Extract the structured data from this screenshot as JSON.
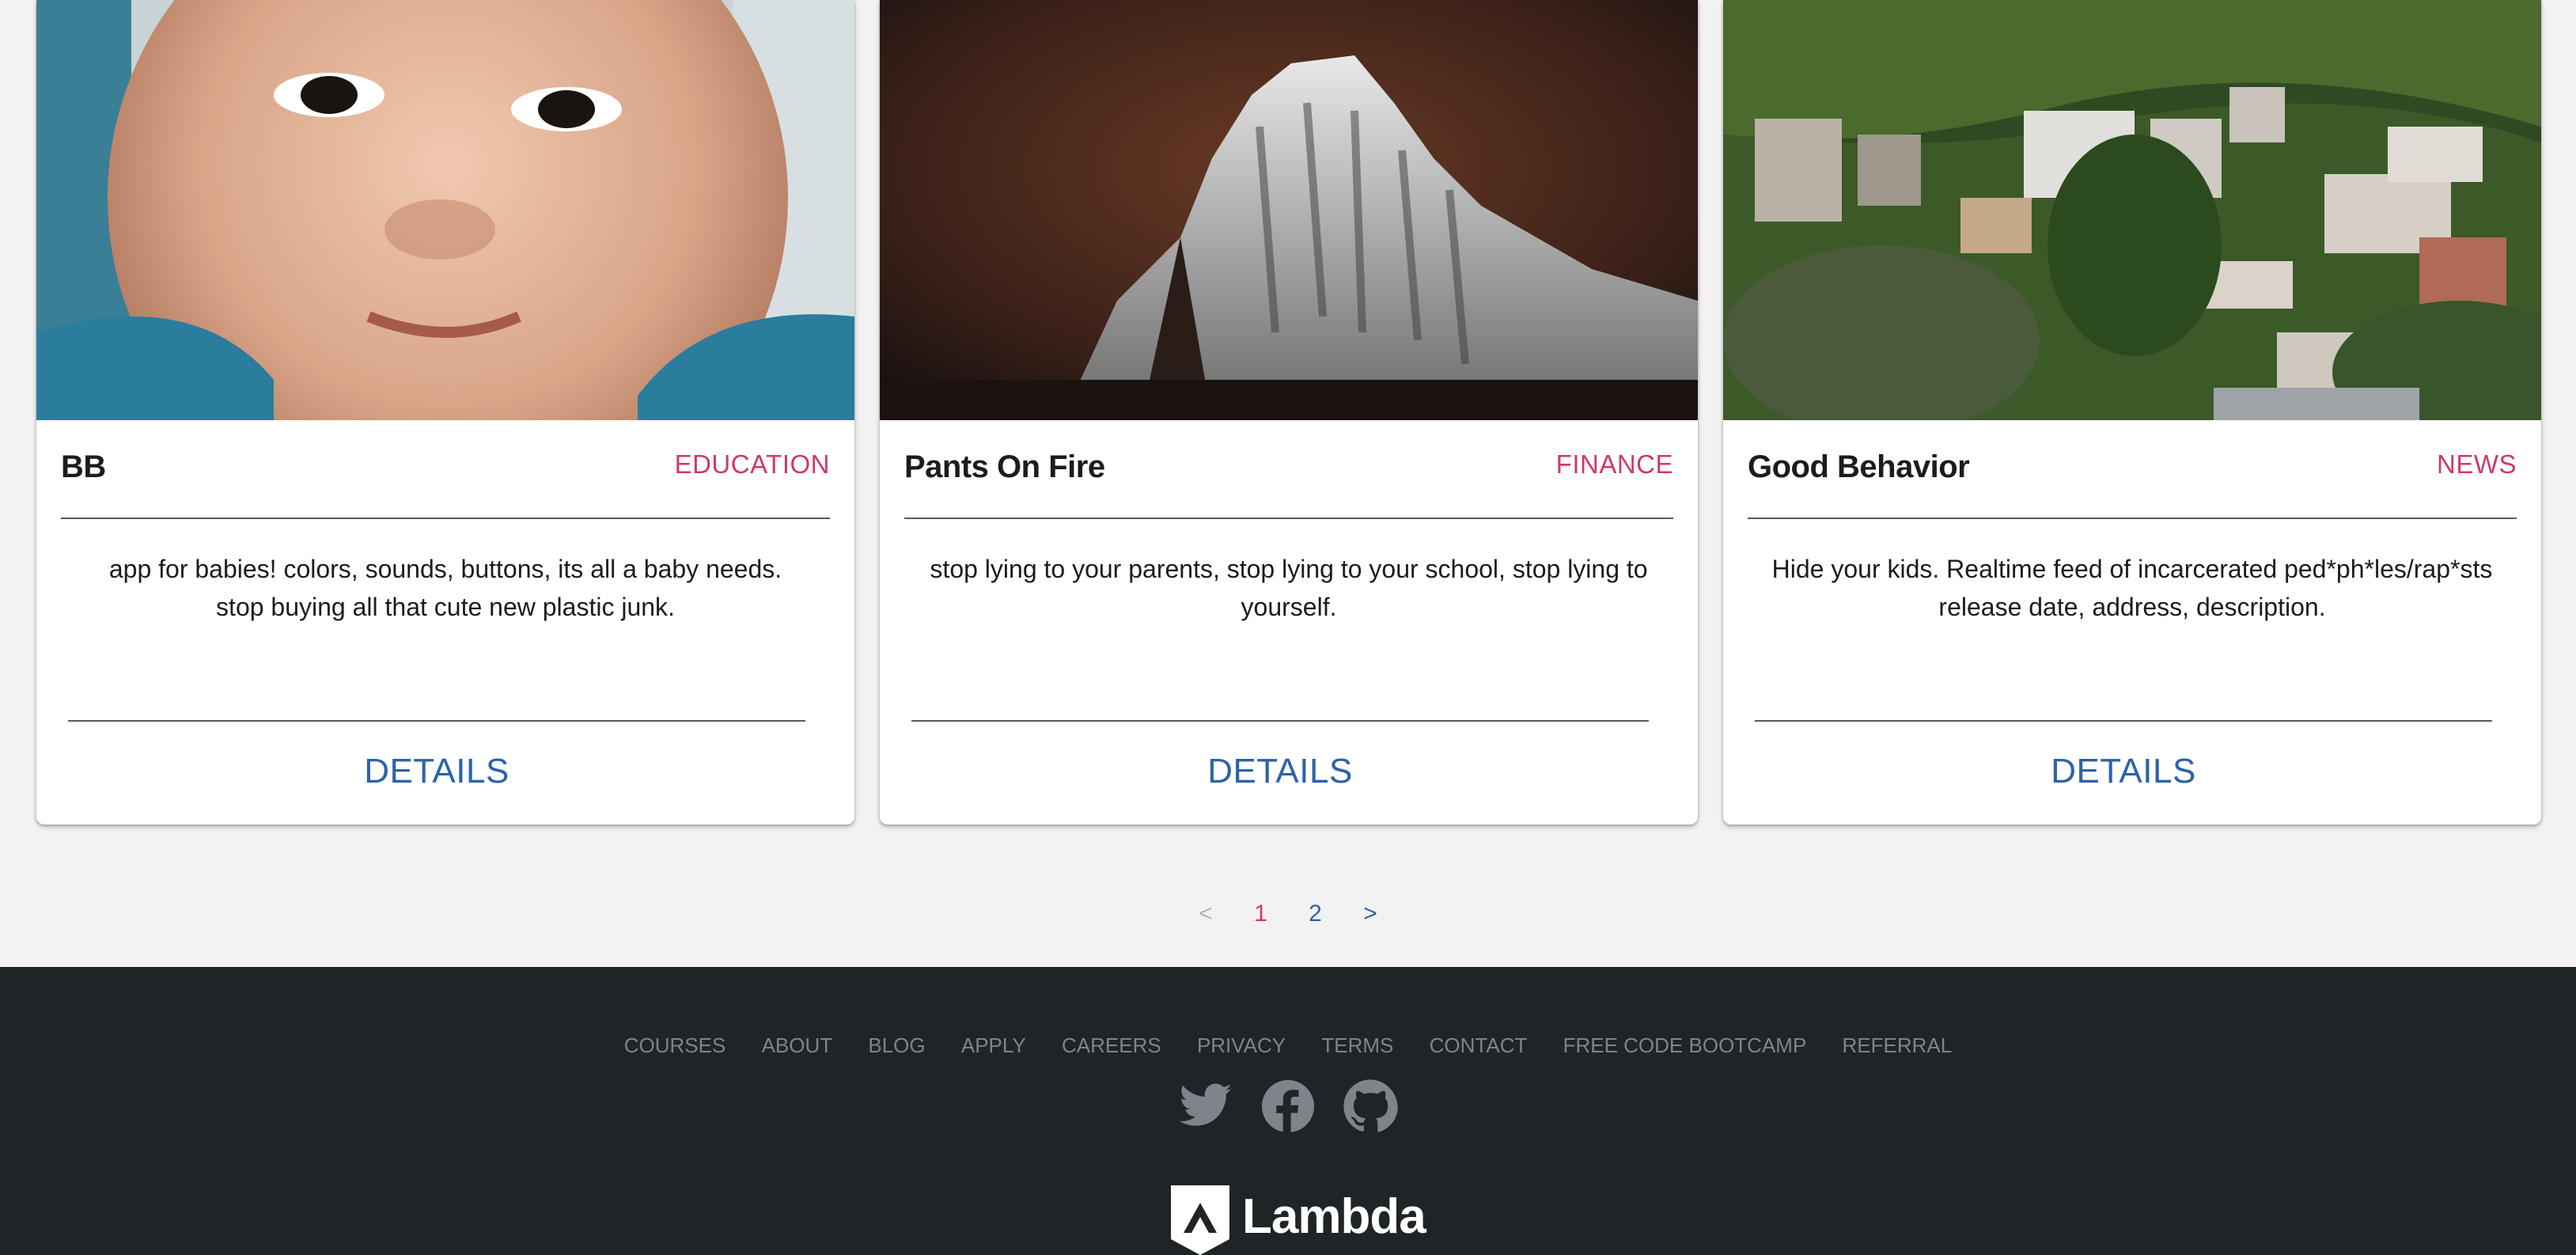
{
  "cards": [
    {
      "image": "baby-face-photo",
      "title": "BB",
      "category": "EDUCATION",
      "description": "app for babies! colors, sounds, buttons, its all a baby needs. stop buying all that cute new plastic junk.",
      "details_label": "DETAILS"
    },
    {
      "image": "rock-formation-photo",
      "title": "Pants On Fire",
      "category": "FINANCE",
      "description": "stop lying to your parents, stop lying to your school, stop lying to yourself.",
      "details_label": "DETAILS"
    },
    {
      "image": "hillside-town-photo",
      "title": "Good Behavior",
      "category": "NEWS",
      "description": "Hide your kids. Realtime feed of incarcerated ped*ph*les/rap*sts release date, address, description.",
      "details_label": "DETAILS"
    }
  ],
  "pagination": {
    "prev": "<",
    "pages": [
      "1",
      "2"
    ],
    "current": "1",
    "next": ">"
  },
  "footer": {
    "links": [
      "COURSES",
      "ABOUT",
      "BLOG",
      "APPLY",
      "CAREERS",
      "PRIVACY",
      "TERMS",
      "CONTACT",
      "FREE CODE BOOTCAMP",
      "REFERRAL"
    ],
    "social": [
      "twitter-icon",
      "facebook-icon",
      "github-icon"
    ],
    "brand": "Lambda"
  },
  "colors": {
    "accent_pink": "#d0386e",
    "link_blue": "#2d63a8",
    "footer_bg": "#1f2427",
    "page_bg": "#f2f2f2"
  }
}
